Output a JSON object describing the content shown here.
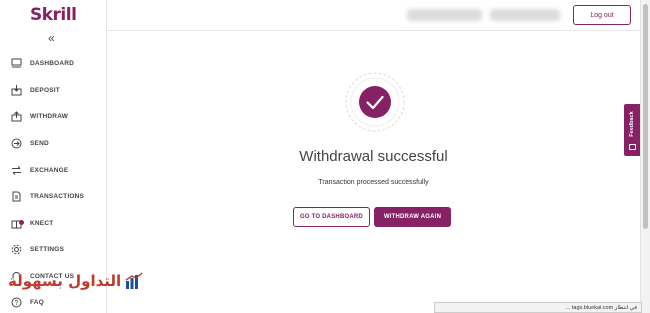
{
  "brand": {
    "logo_text": "Skrill",
    "accent": "#862165"
  },
  "sidebar": {
    "collapse_icon": "double-chevron-left",
    "items": [
      {
        "label": "DASHBOARD",
        "icon": "dashboard-icon"
      },
      {
        "label": "DEPOSIT",
        "icon": "deposit-icon"
      },
      {
        "label": "WITHDRAW",
        "icon": "withdraw-icon"
      },
      {
        "label": "SEND",
        "icon": "send-icon"
      },
      {
        "label": "EXCHANGE",
        "icon": "exchange-icon"
      },
      {
        "label": "TRANSACTIONS",
        "icon": "transactions-icon"
      },
      {
        "label": "KNECT",
        "icon": "knect-icon"
      },
      {
        "label": "SETTINGS",
        "icon": "settings-icon"
      },
      {
        "label": "CONTACT US",
        "icon": "headset-icon"
      },
      {
        "label": "FAQ",
        "icon": "help-icon"
      }
    ]
  },
  "header": {
    "logout_label": "Log out"
  },
  "main": {
    "title": "Withdrawal successful",
    "subtitle": "Transaction processed successfully",
    "dashboard_button": "GO TO DASHBOARD",
    "withdraw_again_button": "WITHDRAW AGAIN"
  },
  "feedback": {
    "label": "Feedback"
  },
  "watermark": {
    "text": "التداول بسهولة"
  },
  "statusbar": {
    "text": "في انتظار tags.bluekai.com ..."
  }
}
